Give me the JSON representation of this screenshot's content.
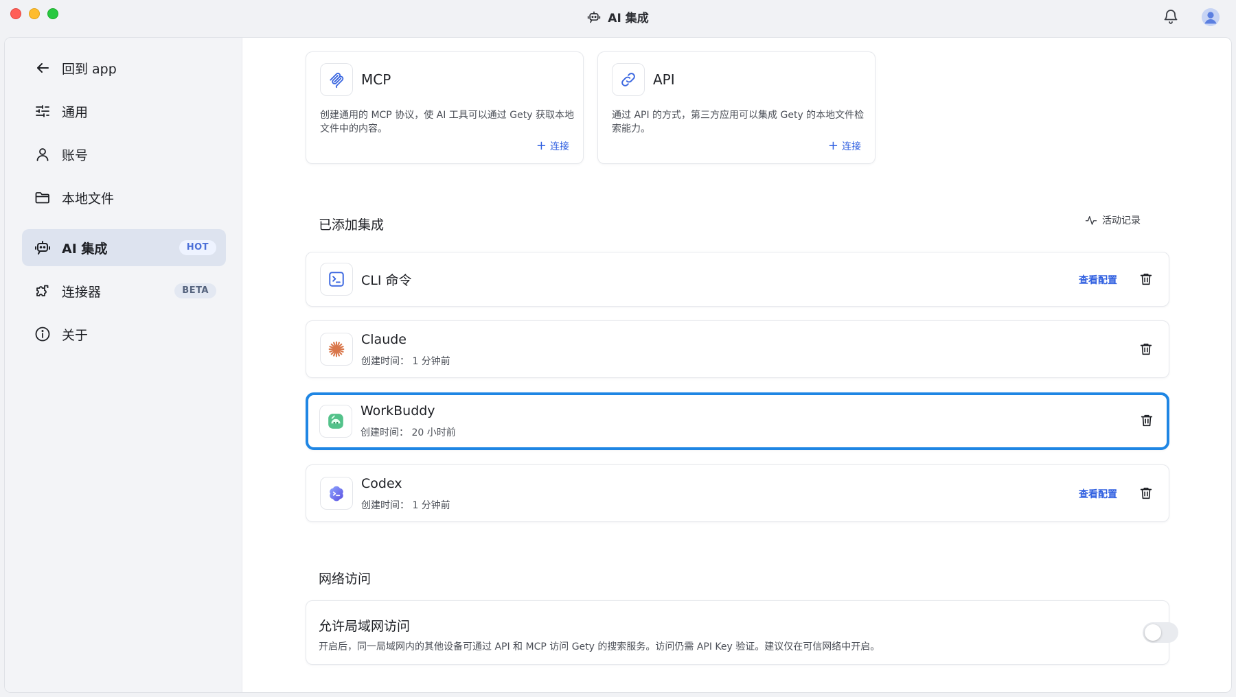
{
  "window": {
    "title": "AI 集成"
  },
  "sidebar": {
    "items": [
      {
        "label": "回到 app",
        "icon": "arrow-left-icon"
      },
      {
        "label": "通用",
        "icon": "sliders-icon"
      },
      {
        "label": "账号",
        "icon": "user-icon"
      },
      {
        "label": "本地文件",
        "icon": "folder-icon"
      },
      {
        "label": "AI 集成",
        "icon": "robot-icon",
        "badge": "HOT",
        "active": true
      },
      {
        "label": "连接器",
        "icon": "puzzle-icon",
        "badge": "BETA"
      },
      {
        "label": "关于",
        "icon": "info-icon"
      }
    ]
  },
  "available": [
    {
      "name": "MCP",
      "icon": "mcp-icon",
      "description": "创建通用的 MCP 协议，使 AI 工具可以通过 Gety 获取本地文件中的内容。",
      "action": "连接"
    },
    {
      "name": "API",
      "icon": "link-icon",
      "description": "通过 API 的方式，第三方应用可以集成 Gety 的本地文件检索能力。",
      "action": "连接"
    }
  ],
  "added": {
    "title": "已添加集成",
    "activity_label": "活动记录",
    "items": [
      {
        "name": "CLI 命令",
        "icon": "terminal-icon",
        "time": "",
        "view_config": "查看配置"
      },
      {
        "name": "Claude",
        "icon": "claude-icon",
        "time": "创建时间： 1 分钟前",
        "view_config": ""
      },
      {
        "name": "WorkBuddy",
        "icon": "workbuddy-icon",
        "time": "创建时间： 20 小时前",
        "view_config": ""
      },
      {
        "name": "Codex",
        "icon": "codex-icon",
        "time": "创建时间： 1 分钟前",
        "view_config": "查看配置"
      }
    ]
  },
  "network": {
    "title": "网络访问",
    "setting_title": "允许局域网访问",
    "setting_desc": "开启后，同一局域网内的其他设备可通过 API 和 MCP 访问 Gety 的搜索服务。访问仍需 API Key 验证。建议仅在可信网络中开启。",
    "enabled": false
  },
  "colors": {
    "accent": "#2f5fe0",
    "selected_outline": "#1f86e4",
    "active_nav_bg": "#dde3ef"
  }
}
